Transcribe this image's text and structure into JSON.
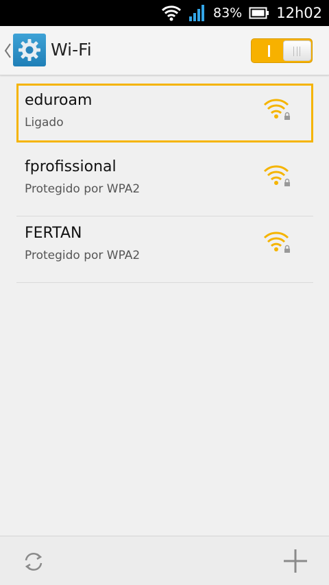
{
  "status_bar": {
    "battery_percent": "83%",
    "time": "12h02",
    "icons": [
      "wifi-icon",
      "cell-signal-icon",
      "battery-icon"
    ]
  },
  "header": {
    "title": "Wi-Fi",
    "app_icon": "settings-gear-icon",
    "back_icon": "chevron-left-icon",
    "wifi_toggle_on": true
  },
  "networks": [
    {
      "name": "eduroam",
      "status": "Ligado",
      "selected": true,
      "icon": "wifi-lock-icon"
    },
    {
      "name": "fprofissional",
      "status": "Protegido por WPA2",
      "selected": false,
      "icon": "wifi-lock-icon"
    },
    {
      "name": "FERTAN",
      "status": "Protegido por WPA2",
      "selected": false,
      "icon": "wifi-lock-icon"
    }
  ],
  "bottom_bar": {
    "left_icon": "refresh-icon",
    "right_icon": "add-icon"
  },
  "colors": {
    "accent": "#f5b400",
    "settings_icon_blue": "#2a8fc8",
    "status_bar_blue": "#33a5e6"
  }
}
